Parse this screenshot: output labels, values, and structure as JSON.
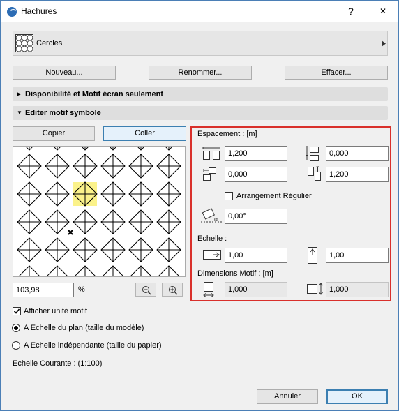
{
  "window": {
    "title": "Hachures",
    "help": "?",
    "close": "✕"
  },
  "fill_selector": {
    "selected": "Cercles"
  },
  "top_buttons": {
    "new": "Nouveau...",
    "rename": "Renommer...",
    "delete": "Effacer..."
  },
  "sections": {
    "availability": "Disponibilité et Motif écran seulement",
    "edit_symbol": "Editer motif symbole"
  },
  "edit": {
    "copy": "Copier",
    "paste": "Coller"
  },
  "preview": {
    "zoom_value": "103,98",
    "zoom_unit": "%"
  },
  "spacing": {
    "header": "Espacement : [m]",
    "h_spacing": "1,200",
    "v_spacing": "0,000",
    "h_offset": "0,000",
    "v_offset": "1,200",
    "regular_arrangement": "Arrangement Régulier",
    "regular_checked": false,
    "angle": "0,00°"
  },
  "scale": {
    "header": "Echelle :",
    "x": "1,00",
    "y": "1,00"
  },
  "pattern_dims": {
    "header": "Dimensions Motif : [m]",
    "width": "1,000",
    "height": "1,000"
  },
  "options": {
    "show_unit": "Afficher unité motif",
    "show_unit_checked": true,
    "scale_plan": "A Echelle du plan (taille du modèle)",
    "scale_paper": "A Echelle indépendante (taille du papier)",
    "selected_scale": "plan",
    "current_scale": "Echelle Courante : (1:100)"
  },
  "footer": {
    "cancel": "Annuler",
    "ok": "OK"
  },
  "colors": {
    "highlight": "#fbf28a",
    "accent_red": "#d9302b",
    "focus_blue": "#3c7fb1"
  }
}
